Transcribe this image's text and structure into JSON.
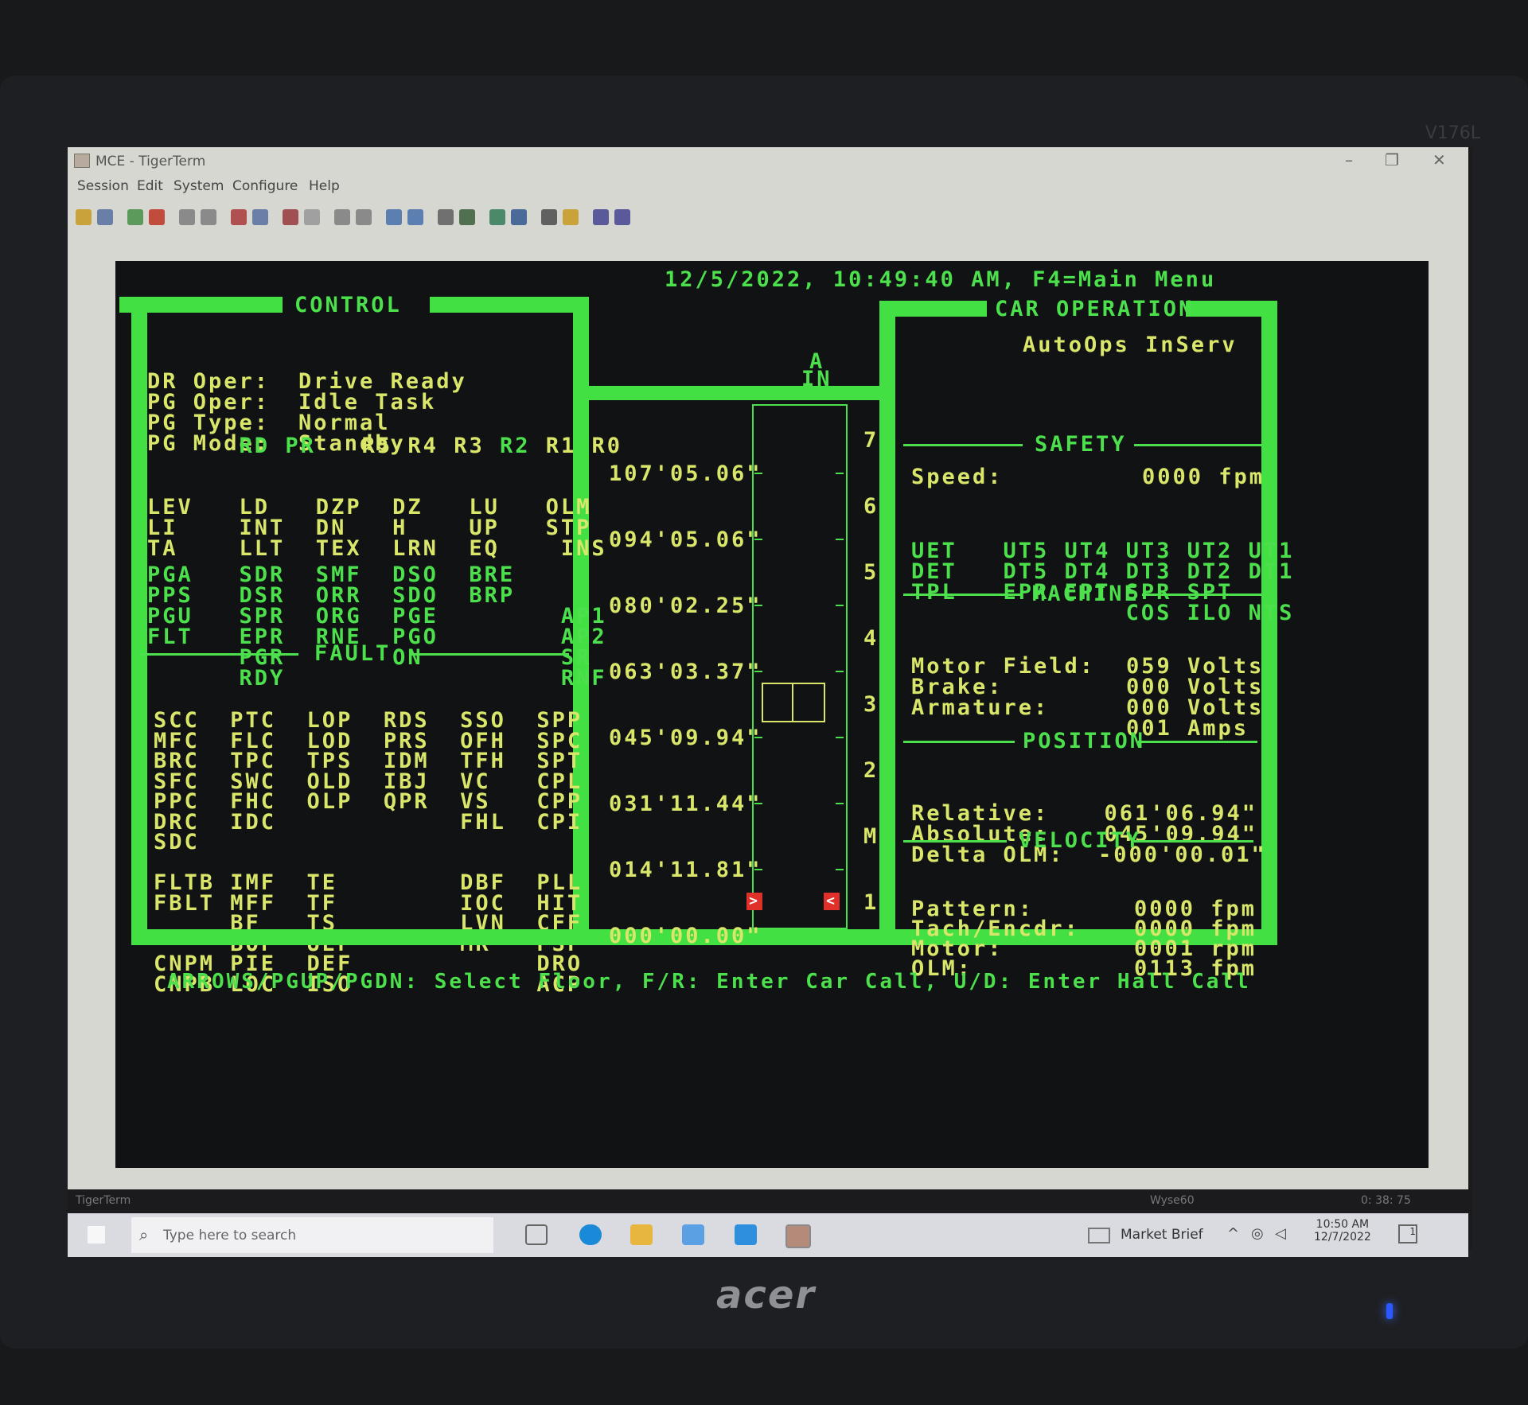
{
  "window": {
    "title": "MCE - TigerTerm",
    "minimize": "–",
    "restore": "❐",
    "close": "✕"
  },
  "menu": [
    "Session",
    "Edit",
    "System",
    "Configure",
    "Help"
  ],
  "toolbar_icons": [
    "open-icon",
    "save-icon",
    "connect-icon",
    "disconnect-icon",
    "copy-icon",
    "paste-icon",
    "send-file-icon",
    "receive-file-icon",
    "transfer-icon",
    "capture-icon",
    "sort-asc-icon",
    "sort-desc-icon",
    "upload-icon",
    "download-icon",
    "print-icon",
    "print-screen-icon",
    "macro-icon",
    "keymap-icon",
    "settings-icon",
    "about-icon",
    "help-icon",
    "exit-icon"
  ],
  "terminal": {
    "datetime": "12/5/2022, 10:49:40 AM, F4=Main Menu",
    "control": {
      "title": "CONTROL",
      "status": [
        {
          "label": "DR Oper:",
          "value": "Drive Ready"
        },
        {
          "label": "PG Oper:",
          "value": "Idle Task"
        },
        {
          "label": "PG Type:",
          "value": "Normal"
        },
        {
          "label": "PG Mode:",
          "value": "Standby"
        }
      ],
      "registers": [
        "RD",
        "PR",
        "R5",
        "R4",
        "R3",
        "R2",
        "R1",
        "R0"
      ],
      "signals_a": [
        "LEV   LD   DZP  DZ   LU   OLM",
        "LI    INT  DN   H    UP   STP",
        "TA    LLT  TEX  LRN  EQ    INS"
      ],
      "signals_b": [
        "PGA   SDR  SMF  DSO  BRE",
        "PPS   DSR  ORR  SDO  BRP",
        "PGU   SPR  ORG  PGE        AP1",
        "FLT   EPR  RNE  PGO        AP2",
        "      PGR       ON         SR",
        "      RDY                  RNF"
      ]
    },
    "fault": {
      "title": "FAULT",
      "lines": [
        "SCC  PTC  LOP  RDS  SSO  SPP",
        "MFC  FLC  LOD  PRS  OFH  SPC",
        "BRC  TPC  TPS  IDM  TFH  SPT",
        "SFC  SWC  OLD  IBJ  VC   CPL",
        "PPC  FHC  OLP  QPR  VS   CPP",
        "DRC  IDC            FHL  CPI",
        "SDC",
        "",
        "FLTB IMF  TE        DBF  PLL",
        "FBLT MFF  TF        IOC  HIT",
        "     BF   TS        LVN  CFF",
        "     BOF  UEF       MR   PSF",
        "CNPM PIE  DEF            DRO",
        "CNPB LOC  ISO            ACP"
      ]
    },
    "hoistway": {
      "car": "A",
      "car_status": "IN",
      "floors": [
        "7",
        "6",
        "5",
        "4",
        "3",
        "2",
        "M",
        "1"
      ],
      "positions": [
        "107'05.06\"",
        "094'05.06\"",
        "080'02.25\"",
        "063'03.37\"",
        "045'09.94\"",
        "031'11.44\"",
        "014'11.81\"",
        "000'00.00\""
      ],
      "car_floor": "3",
      "marker_left": ">",
      "marker_right": "<"
    },
    "car_operation": {
      "title": "CAR OPERATION",
      "mode": "AutoOps InServ",
      "safety_title": "SAFETY",
      "speed_label": "Speed:",
      "speed_value": "0000 fpm",
      "safety_lines": [
        "UET   UT5 UT4 UT3 UT2 UT1",
        "DET   DT5 DT4 DT3 DT2 DT1",
        "TPL   EPR EPT SPR SPT",
        "              COS ILO NTS"
      ],
      "machine_title": "MACHINE",
      "machine": [
        {
          "label": "Motor Field:",
          "value": "059 Volts"
        },
        {
          "label": "Brake:",
          "value": "000 Volts"
        },
        {
          "label": "Armature:",
          "value": "000 Volts"
        },
        {
          "label": "",
          "value": "001 Amps"
        }
      ],
      "position_title": "POSITION",
      "position": [
        {
          "label": "Relative:",
          "value": "061'06.94\""
        },
        {
          "label": "Absolute:",
          "value": "045'09.94\""
        },
        {
          "label": "Delta OLM:",
          "value": "-000'00.01\""
        }
      ],
      "velocity_title": "VELOCITY",
      "velocity": [
        {
          "label": "Pattern:",
          "value": "0000 fpm"
        },
        {
          "label": "Tach/Encdr:",
          "value": "0000 fpm"
        },
        {
          "label": "Motor:",
          "value": "0001 rpm"
        },
        {
          "label": "OLM:",
          "value": "0113 fpm"
        }
      ]
    },
    "help_line": "ARROWS/PGUP/PGDN: Select Floor, F/R: Enter Car Call, U/D: Enter Hall Call"
  },
  "statusbar": {
    "app": "TigerTerm",
    "emulation": "Wyse60",
    "elapsed": "0: 38: 75"
  },
  "taskbar": {
    "search_placeholder": "Type here to search",
    "news": "Market Brief",
    "time": "10:50 AM",
    "date": "12/7/2022",
    "notifications": "1"
  },
  "monitor": {
    "brand": "acer",
    "model": "V176L"
  },
  "colors": {
    "terminal_bg": "#101214",
    "terminal_green": "#4ce04c",
    "terminal_yellow": "#d9e66a",
    "alarm_red": "#e0302a"
  }
}
